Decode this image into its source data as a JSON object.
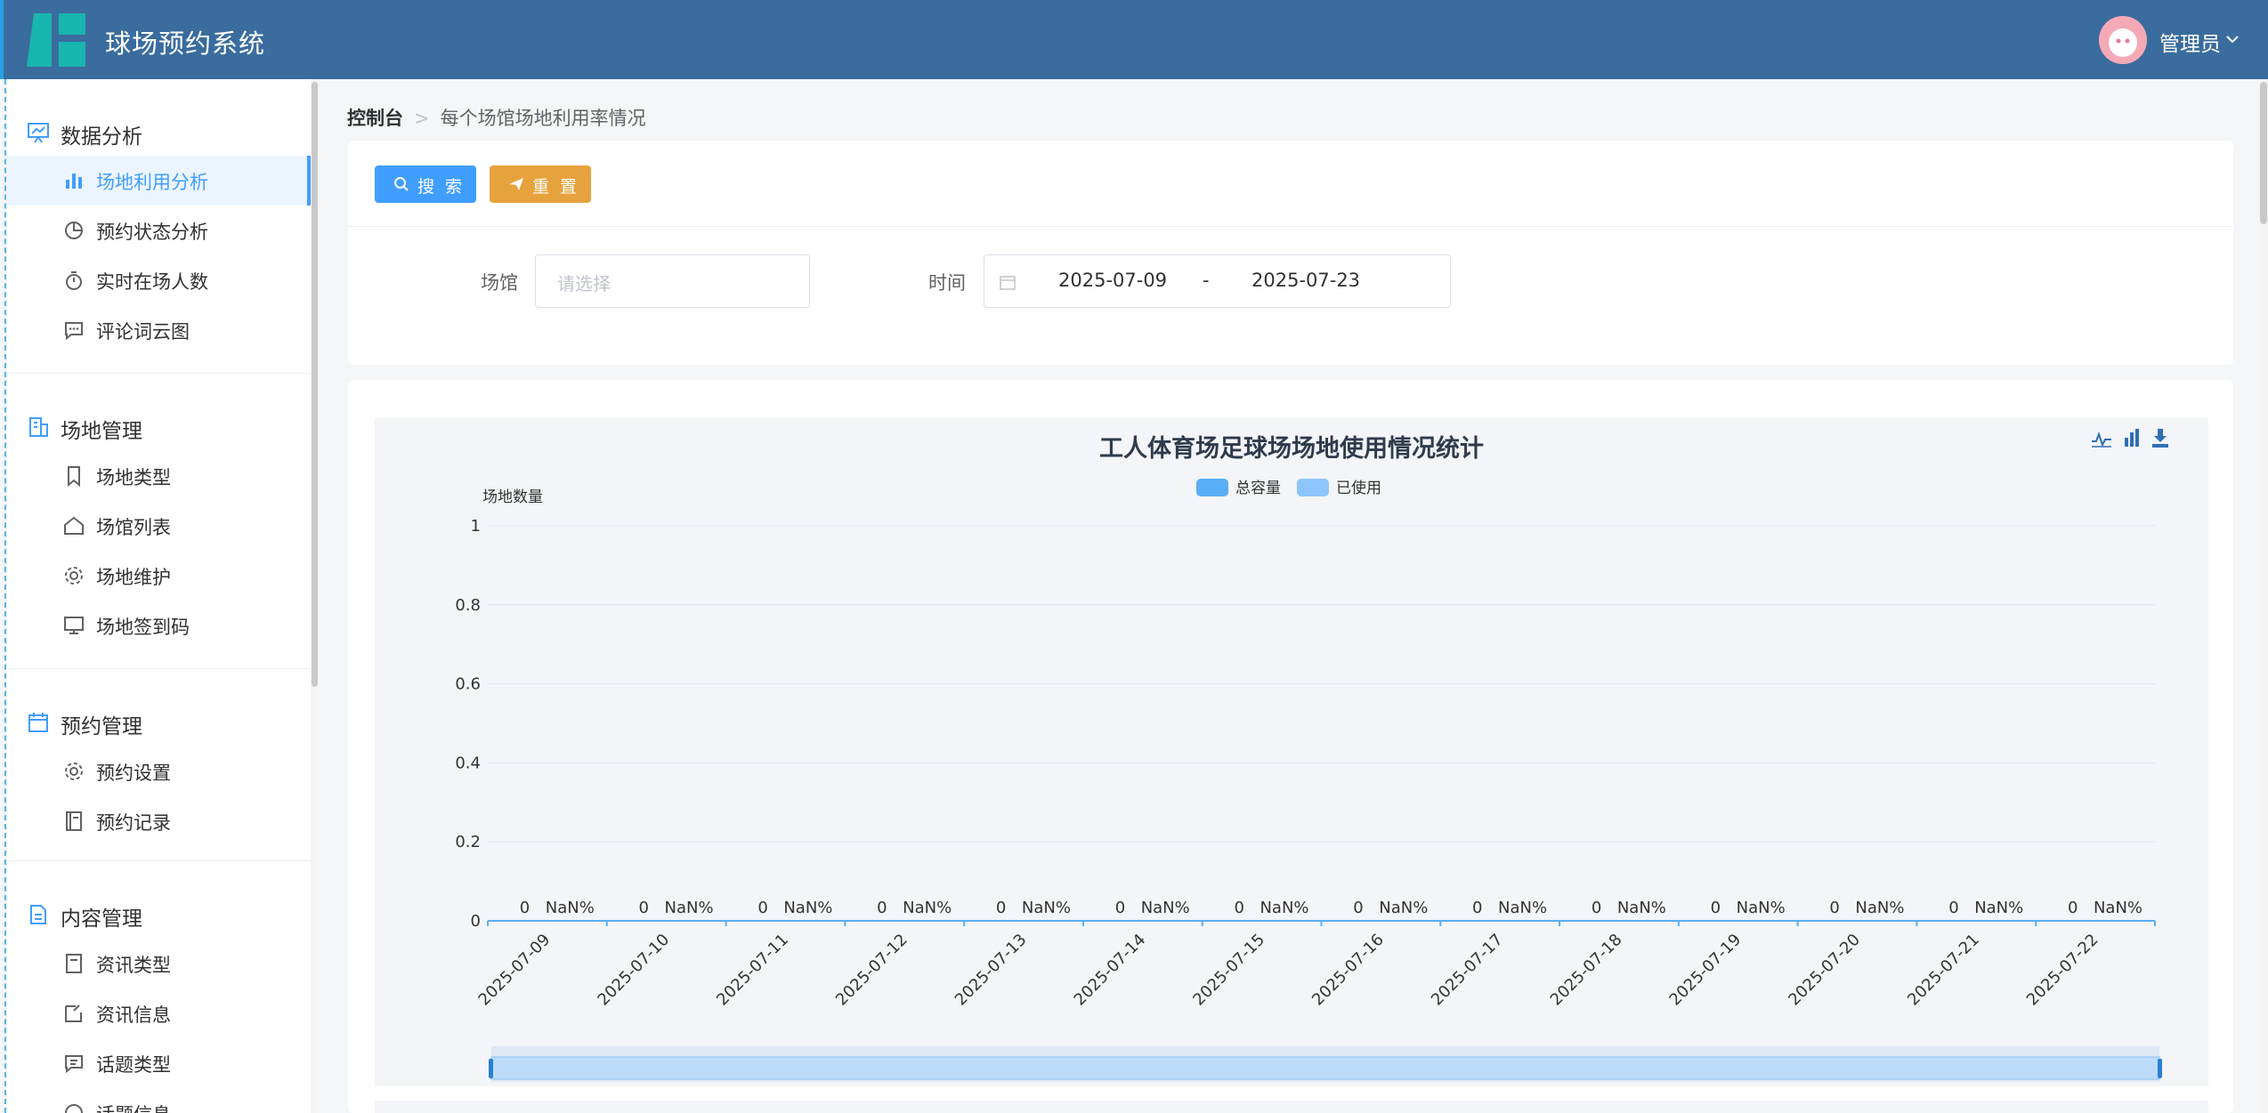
{
  "app": {
    "title": "球场预约系统"
  },
  "user": {
    "name": "管理员"
  },
  "sidebar": {
    "groups": [
      {
        "title": "数据分析",
        "icon": "presentation-chart-icon",
        "items": [
          {
            "label": "场地利用分析",
            "icon": "bar-chart-icon",
            "active": true
          },
          {
            "label": "预约状态分析",
            "icon": "pie-chart-icon"
          },
          {
            "label": "实时在场人数",
            "icon": "stopwatch-icon"
          },
          {
            "label": "评论词云图",
            "icon": "chat-dots-icon"
          }
        ]
      },
      {
        "title": "场地管理",
        "icon": "office-building-icon",
        "items": [
          {
            "label": "场地类型",
            "icon": "bookmark-icon"
          },
          {
            "label": "场馆列表",
            "icon": "house-icon"
          },
          {
            "label": "场地维护",
            "icon": "setting-icon"
          },
          {
            "label": "场地签到码",
            "icon": "monitor-icon"
          }
        ]
      },
      {
        "title": "预约管理",
        "icon": "calendar-icon",
        "items": [
          {
            "label": "预约设置",
            "icon": "setting-icon"
          },
          {
            "label": "预约记录",
            "icon": "notebook-icon"
          }
        ]
      },
      {
        "title": "内容管理",
        "icon": "document-icon",
        "items": [
          {
            "label": "资讯类型",
            "icon": "collection-icon"
          },
          {
            "label": "资讯信息",
            "icon": "edit-note-icon"
          },
          {
            "label": "话题类型",
            "icon": "chat-square-icon"
          },
          {
            "label": "话题信息",
            "icon": "chat-round-icon"
          }
        ]
      }
    ]
  },
  "breadcrumb": {
    "home": "控制台",
    "separator": ">",
    "current": "每个场馆场地利用率情况"
  },
  "search": {
    "search_label": "搜 索",
    "reset_label": "重 置",
    "venue_label": "场馆",
    "venue_placeholder": "请选择",
    "time_label": "时间",
    "date_start": "2025-07-09",
    "date_sep": "-",
    "date_end": "2025-07-23"
  },
  "chart_data": {
    "type": "bar",
    "title": "工人体育场足球场场地使用情况统计",
    "ylabel": "场地数量",
    "xlabel": "",
    "ylim": [
      0,
      1
    ],
    "yticks": [
      0,
      0.2,
      0.4,
      0.6,
      0.8,
      1
    ],
    "legend_position": "top-center",
    "toolbox": [
      "line-chart-icon",
      "bar-chart-icon",
      "download-icon"
    ],
    "categories": [
      "2025-07-09",
      "2025-07-10",
      "2025-07-11",
      "2025-07-12",
      "2025-07-13",
      "2025-07-14",
      "2025-07-15",
      "2025-07-16",
      "2025-07-17",
      "2025-07-18",
      "2025-07-19",
      "2025-07-20",
      "2025-07-21",
      "2025-07-22"
    ],
    "series": [
      {
        "name": "总容量",
        "values": [
          0,
          0,
          0,
          0,
          0,
          0,
          0,
          0,
          0,
          0,
          0,
          0,
          0,
          0
        ],
        "labels": [
          "0",
          "0",
          "0",
          "0",
          "0",
          "0",
          "0",
          "0",
          "0",
          "0",
          "0",
          "0",
          "0",
          "0"
        ],
        "color": "#5aaef5"
      },
      {
        "name": "已使用",
        "values": [
          0,
          0,
          0,
          0,
          0,
          0,
          0,
          0,
          0,
          0,
          0,
          0,
          0,
          0
        ],
        "labels": [
          "NaN%",
          "NaN%",
          "NaN%",
          "NaN%",
          "NaN%",
          "NaN%",
          "NaN%",
          "NaN%",
          "NaN%",
          "NaN%",
          "NaN%",
          "NaN%",
          "NaN%",
          "NaN%"
        ],
        "color": "#8ec5fc"
      }
    ],
    "datazoom": {
      "start": 0,
      "end": 100
    }
  },
  "colors": {
    "header": "#3a6c9e",
    "primary": "#409eff",
    "warning": "#e6a23c"
  }
}
